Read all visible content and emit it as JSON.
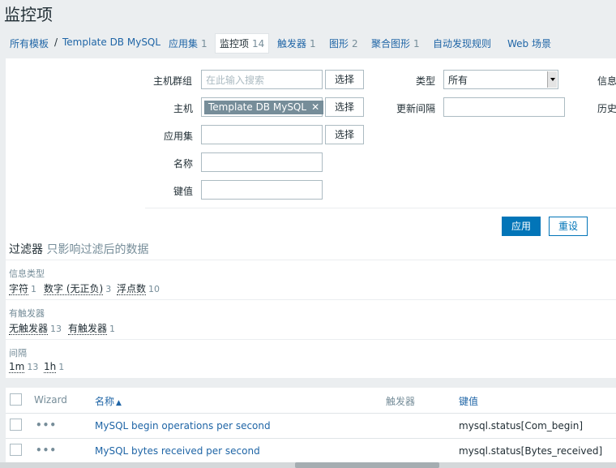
{
  "page_title": "监控项",
  "nav": {
    "all_templates": "所有模板",
    "separator": "/",
    "template": "Template DB MySQL",
    "tabs": [
      {
        "label": "应用集",
        "count": "1"
      },
      {
        "label": "监控项",
        "count": "14"
      },
      {
        "label": "触发器",
        "count": "1"
      },
      {
        "label": "图形",
        "count": "2"
      },
      {
        "label": "聚合图形",
        "count": "1"
      },
      {
        "label": "自动发现规则",
        "count": ""
      },
      {
        "label": "Web 场景",
        "count": ""
      }
    ]
  },
  "filter": {
    "host_group_label": "主机群组",
    "host_group_placeholder": "在此输入搜索",
    "host_label": "主机",
    "host_chip": "Template DB MySQL",
    "app_label": "应用集",
    "name_label": "名称",
    "key_label": "键值",
    "select_btn": "选择",
    "type_label": "类型",
    "type_value": "所有",
    "interval_label": "更新间隔",
    "info_label": "信息",
    "history_label": "历史",
    "apply_btn": "应用",
    "reset_btn": "重设"
  },
  "subfilter": {
    "title": "过滤器",
    "hint": "只影响过滤后的数据",
    "sections": [
      {
        "label": "信息类型",
        "items": [
          {
            "name": "字符",
            "count": "1"
          },
          {
            "name": "数字 (无正负)",
            "count": "3"
          },
          {
            "name": "浮点数",
            "count": "10"
          }
        ]
      },
      {
        "label": "有触发器",
        "items": [
          {
            "name": "无触发器",
            "count": "13"
          },
          {
            "name": "有触发器",
            "count": "1"
          }
        ]
      },
      {
        "label": "间隔",
        "items": [
          {
            "name": "1m",
            "count": "13"
          },
          {
            "name": "1h",
            "count": "1"
          }
        ]
      }
    ]
  },
  "table": {
    "headers": {
      "wizard": "Wizard",
      "name": "名称",
      "triggers": "触发器",
      "key": "键值"
    },
    "rows": [
      {
        "name": "MySQL begin operations per second",
        "key": "mysql.status[Com_begin]"
      },
      {
        "name": "MySQL bytes received per second",
        "key": "mysql.status[Bytes_received]"
      }
    ]
  }
}
